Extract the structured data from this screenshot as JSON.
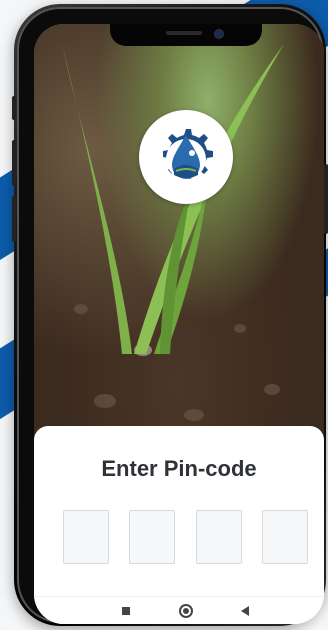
{
  "app": {
    "logo_icon": "water-drop-gear-farm-logo",
    "brand_colors": {
      "primary_blue": "#0d5cab",
      "logo_dark": "#1d4f86"
    }
  },
  "pin_entry": {
    "title": "Enter Pin-code",
    "digits": [
      "",
      "",
      "",
      ""
    ]
  },
  "system_nav": {
    "recent_icon": "square-icon",
    "home_icon": "circle-icon",
    "back_icon": "triangle-back-icon"
  }
}
